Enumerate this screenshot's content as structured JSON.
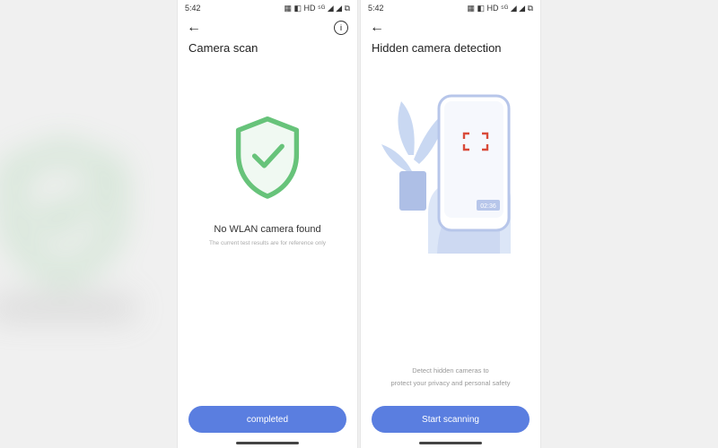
{
  "status": {
    "time": "5:42",
    "indicators": "▦ ◧ HD ⁵ᴳ ◢ ◢ ⧉"
  },
  "left": {
    "title": "Camera scan",
    "result_heading": "No WLAN camera found",
    "result_sub": "The current test results are for reference only",
    "cta": "completed"
  },
  "right": {
    "title": "Hidden camera detection",
    "illus_time": "02:36",
    "desc_line1": "Detect hidden cameras to",
    "desc_line2": "protect your privacy and personal safety",
    "cta": "Start scanning"
  },
  "icons": {
    "back": "←",
    "info": "i"
  }
}
